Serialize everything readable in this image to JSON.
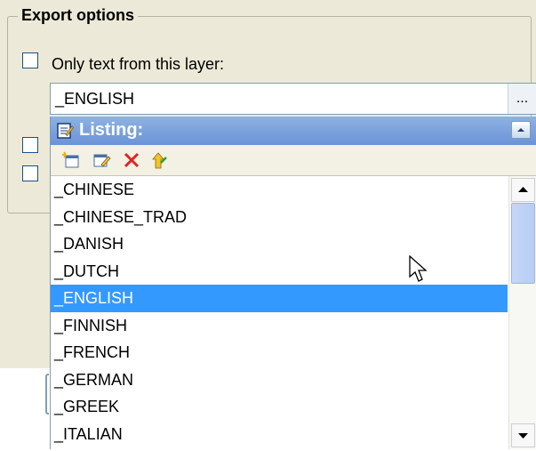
{
  "group": {
    "title": "Export options"
  },
  "checkbox_layer": {
    "label": "Only text from this layer:"
  },
  "layer_field": {
    "value": "_ENGLISH",
    "button": "..."
  },
  "popup": {
    "title": "Listing:",
    "toolbar": [
      "new-item-icon",
      "edit-icon",
      "delete-icon",
      "move-up-icon"
    ]
  },
  "list": {
    "items": [
      "_CHINESE",
      "_CHINESE_TRAD",
      "_DANISH",
      "_DUTCH",
      "_ENGLISH",
      "_FINNISH",
      "_FRENCH",
      "_GERMAN",
      "_GREEK",
      "_ITALIAN"
    ],
    "selected_index": 4
  },
  "colors": {
    "accent": "#3399ff",
    "header": "#7ea3dd"
  }
}
